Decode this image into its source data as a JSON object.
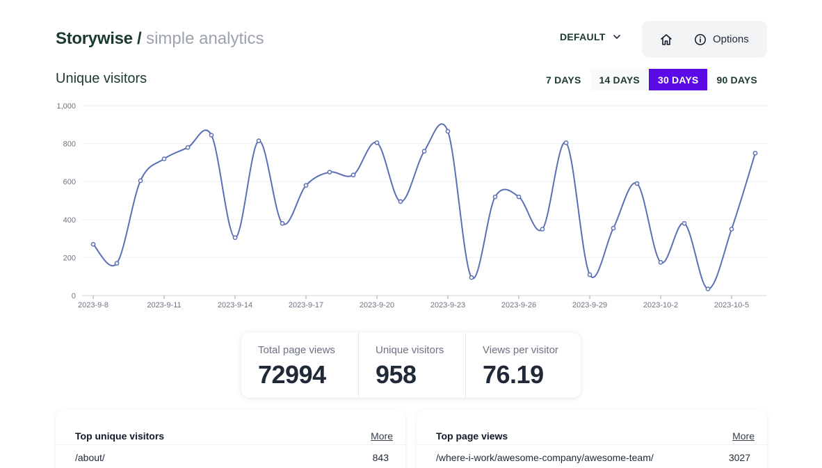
{
  "header": {
    "brand_name": "Storywise /",
    "brand_sub": " simple analytics",
    "environment": "DEFAULT",
    "options_label": "Options"
  },
  "section_title": "Unique visitors",
  "range_tabs": [
    "7 DAYS",
    "14 DAYS",
    "30 DAYS",
    "90 DAYS"
  ],
  "active_range": "30 DAYS",
  "colors": {
    "accent": "#5b0be6",
    "line": "#5b6fb5",
    "brand": "#1b3a2b"
  },
  "chart_data": {
    "type": "line",
    "title": "",
    "xlabel": "",
    "ylabel": "",
    "ylim": [
      0,
      1000
    ],
    "yticks": [
      "0",
      "200",
      "400",
      "600",
      "800",
      "1,000"
    ],
    "x": [
      "2023-9-8",
      "2023-9-9",
      "2023-9-10",
      "2023-9-11",
      "2023-9-12",
      "2023-9-13",
      "2023-9-14",
      "2023-9-15",
      "2023-9-16",
      "2023-9-17",
      "2023-9-18",
      "2023-9-19",
      "2023-9-20",
      "2023-9-21",
      "2023-9-22",
      "2023-9-23",
      "2023-9-24",
      "2023-9-25",
      "2023-9-26",
      "2023-9-27",
      "2023-9-28",
      "2023-9-29",
      "2023-9-30",
      "2023-10-1",
      "2023-10-2",
      "2023-10-3",
      "2023-10-4",
      "2023-10-5",
      "2023-10-6"
    ],
    "xtick_labels": [
      "2023-9-8",
      "2023-9-11",
      "2023-9-14",
      "2023-9-17",
      "2023-9-20",
      "2023-9-23",
      "2023-9-26",
      "2023-9-29",
      "2023-10-2",
      "2023-10-5"
    ],
    "series": [
      {
        "name": "",
        "values": [
          270,
          170,
          605,
          720,
          780,
          845,
          305,
          815,
          380,
          580,
          650,
          635,
          805,
          495,
          760,
          865,
          95,
          520,
          520,
          350,
          805,
          110,
          355,
          590,
          175,
          380,
          35,
          350,
          750
        ]
      }
    ],
    "grid": true,
    "legend": "none"
  },
  "stats": [
    {
      "label": "Total page views",
      "value": "72994"
    },
    {
      "label": "Unique visitors",
      "value": "958"
    },
    {
      "label": "Views per visitor",
      "value": "76.19"
    }
  ],
  "panels": {
    "left": {
      "title": "Top unique visitors",
      "more": "More",
      "rows": [
        {
          "path": "/about/",
          "count": "843"
        }
      ]
    },
    "right": {
      "title": "Top page views",
      "more": "More",
      "rows": [
        {
          "path": "/where-i-work/awesome-company/awesome-team/",
          "count": "3027"
        }
      ]
    }
  }
}
